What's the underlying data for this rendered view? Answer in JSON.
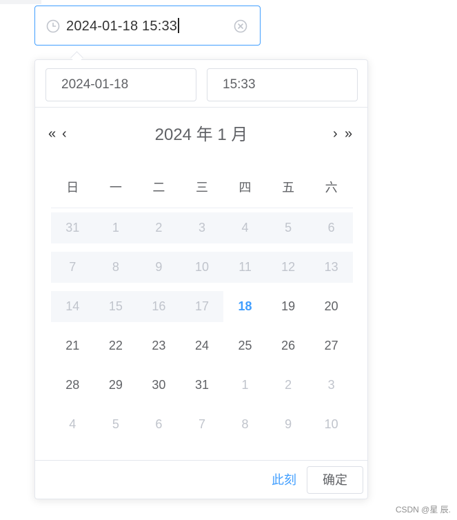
{
  "input": {
    "value": "2024-01-18 15:33",
    "clock_icon": "clock-icon",
    "clear_icon": "circle-close-icon",
    "accent": "#409eff"
  },
  "picker": {
    "date_value": "2024-01-18",
    "time_value": "15:33",
    "nav": {
      "prev_year": "«",
      "prev_month": "‹",
      "next_month": "›",
      "next_year": "»"
    },
    "month_label": "2024 年  1 月",
    "weekdays": [
      "日",
      "一",
      "二",
      "三",
      "四",
      "五",
      "六"
    ],
    "weeks": [
      [
        {
          "day": "31",
          "state": "disabled"
        },
        {
          "day": "1",
          "state": "disabled"
        },
        {
          "day": "2",
          "state": "disabled"
        },
        {
          "day": "3",
          "state": "disabled"
        },
        {
          "day": "4",
          "state": "disabled"
        },
        {
          "day": "5",
          "state": "disabled"
        },
        {
          "day": "6",
          "state": "disabled"
        }
      ],
      [
        {
          "day": "7",
          "state": "disabled"
        },
        {
          "day": "8",
          "state": "disabled"
        },
        {
          "day": "9",
          "state": "disabled"
        },
        {
          "day": "10",
          "state": "disabled"
        },
        {
          "day": "11",
          "state": "disabled"
        },
        {
          "day": "12",
          "state": "disabled"
        },
        {
          "day": "13",
          "state": "disabled"
        }
      ],
      [
        {
          "day": "14",
          "state": "disabled"
        },
        {
          "day": "15",
          "state": "disabled"
        },
        {
          "day": "16",
          "state": "disabled"
        },
        {
          "day": "17",
          "state": "disabled"
        },
        {
          "day": "18",
          "state": "today"
        },
        {
          "day": "19",
          "state": "available"
        },
        {
          "day": "20",
          "state": "available"
        }
      ],
      [
        {
          "day": "21",
          "state": "available"
        },
        {
          "day": "22",
          "state": "available"
        },
        {
          "day": "23",
          "state": "available"
        },
        {
          "day": "24",
          "state": "available"
        },
        {
          "day": "25",
          "state": "available"
        },
        {
          "day": "26",
          "state": "available"
        },
        {
          "day": "27",
          "state": "available"
        }
      ],
      [
        {
          "day": "28",
          "state": "available"
        },
        {
          "day": "29",
          "state": "available"
        },
        {
          "day": "30",
          "state": "available"
        },
        {
          "day": "31",
          "state": "available"
        },
        {
          "day": "1",
          "state": "other"
        },
        {
          "day": "2",
          "state": "other"
        },
        {
          "day": "3",
          "state": "other"
        }
      ],
      [
        {
          "day": "4",
          "state": "other"
        },
        {
          "day": "5",
          "state": "other"
        },
        {
          "day": "6",
          "state": "other"
        },
        {
          "day": "7",
          "state": "other"
        },
        {
          "day": "8",
          "state": "other"
        },
        {
          "day": "9",
          "state": "other"
        },
        {
          "day": "10",
          "state": "other"
        }
      ]
    ],
    "footer": {
      "now_label": "此刻",
      "confirm_label": "确定"
    }
  },
  "watermark": "CSDN @星 辰."
}
